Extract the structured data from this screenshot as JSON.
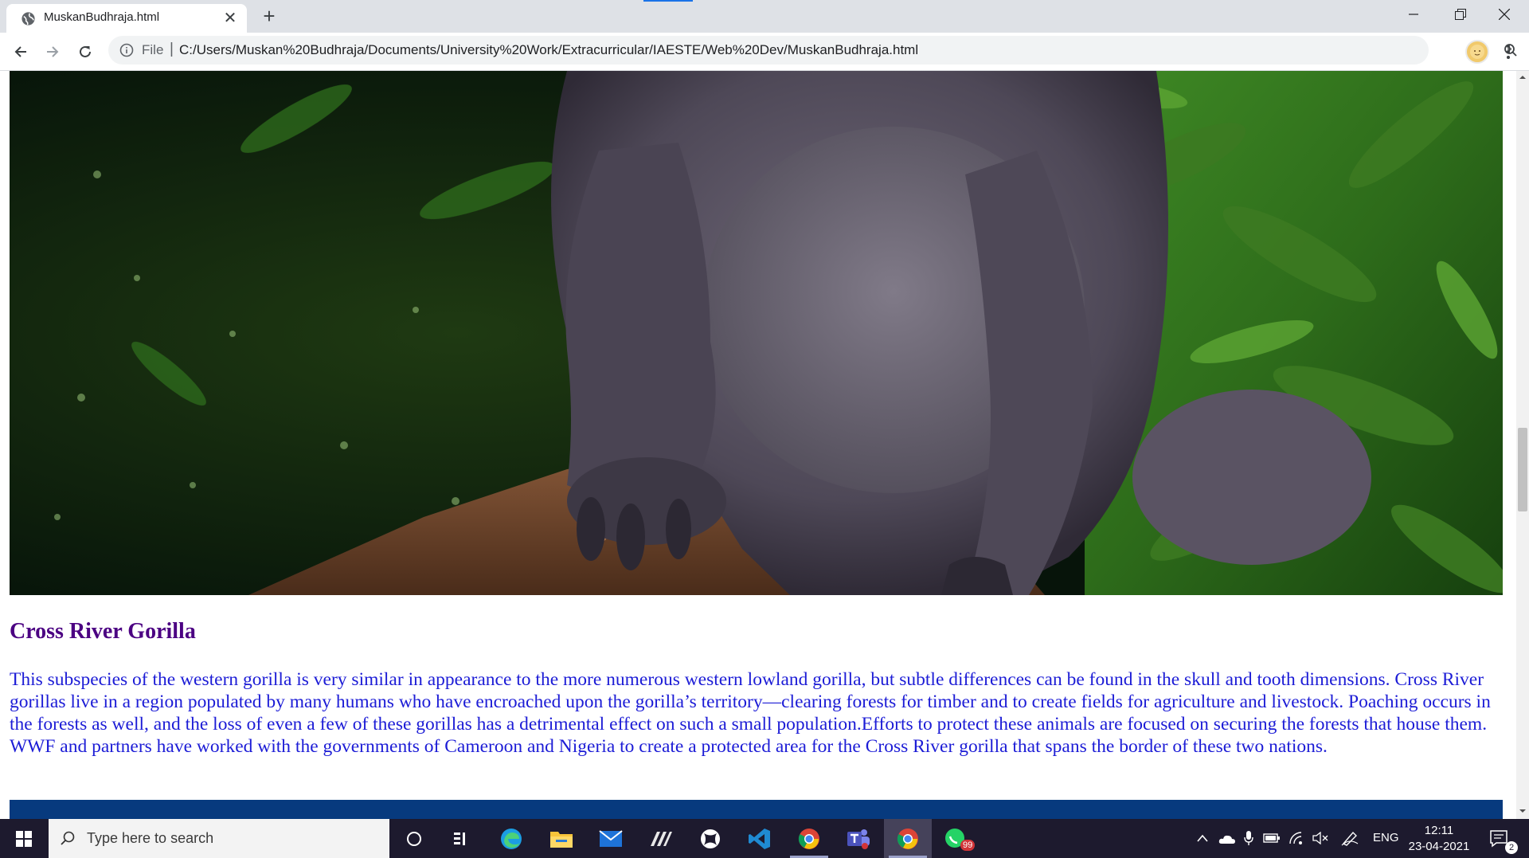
{
  "browser": {
    "tab_title": "MuskanBudhraja.html",
    "tab_close_label": "✕",
    "new_tab_label": "+",
    "scheme_label": "File",
    "url": "C:/Users/Muskan%20Budhraja/Documents/University%20Work/Extracurricular/IAESTE/Web%20Dev/MuskanBudhraja.html",
    "accent_color": "#1a73e8"
  },
  "page": {
    "heading": "Cross River Gorilla",
    "body": "This subspecies of the western gorilla is very similar in appearance to the more numerous western lowland gorilla, but subtle differences can be found in the skull and tooth dimensions. Cross River gorillas live in a region populated by many humans who have encroached upon the gorilla’s territory—clearing forests for timber and to create fields for agriculture and livestock. Poaching occurs in the forests as well, and the loss of even a few of these gorillas has a detrimental effect on such a small population.Efforts to protect these animals are focused on securing the forests that house them. WWF and partners have worked with the governments of Cameroon and Nigeria to create a protected area for the Cross River gorilla that spans the border of these two nations.",
    "heading_color": "#4b0082",
    "body_color": "#1c1cd6"
  },
  "taskbar": {
    "search_placeholder": "Type here to search",
    "whatsapp_badge": "99",
    "language": "ENG",
    "time": "12:11",
    "date": "23-04-2021",
    "notification_count": "2",
    "icons": [
      "cortana-icon",
      "task-view-icon",
      "edge-icon",
      "file-explorer-icon",
      "mail-icon",
      "dev-app-icon",
      "xbox-icon",
      "vscode-icon",
      "chrome-icon",
      "teams-icon",
      "chrome-active-icon",
      "whatsapp-icon"
    ]
  }
}
